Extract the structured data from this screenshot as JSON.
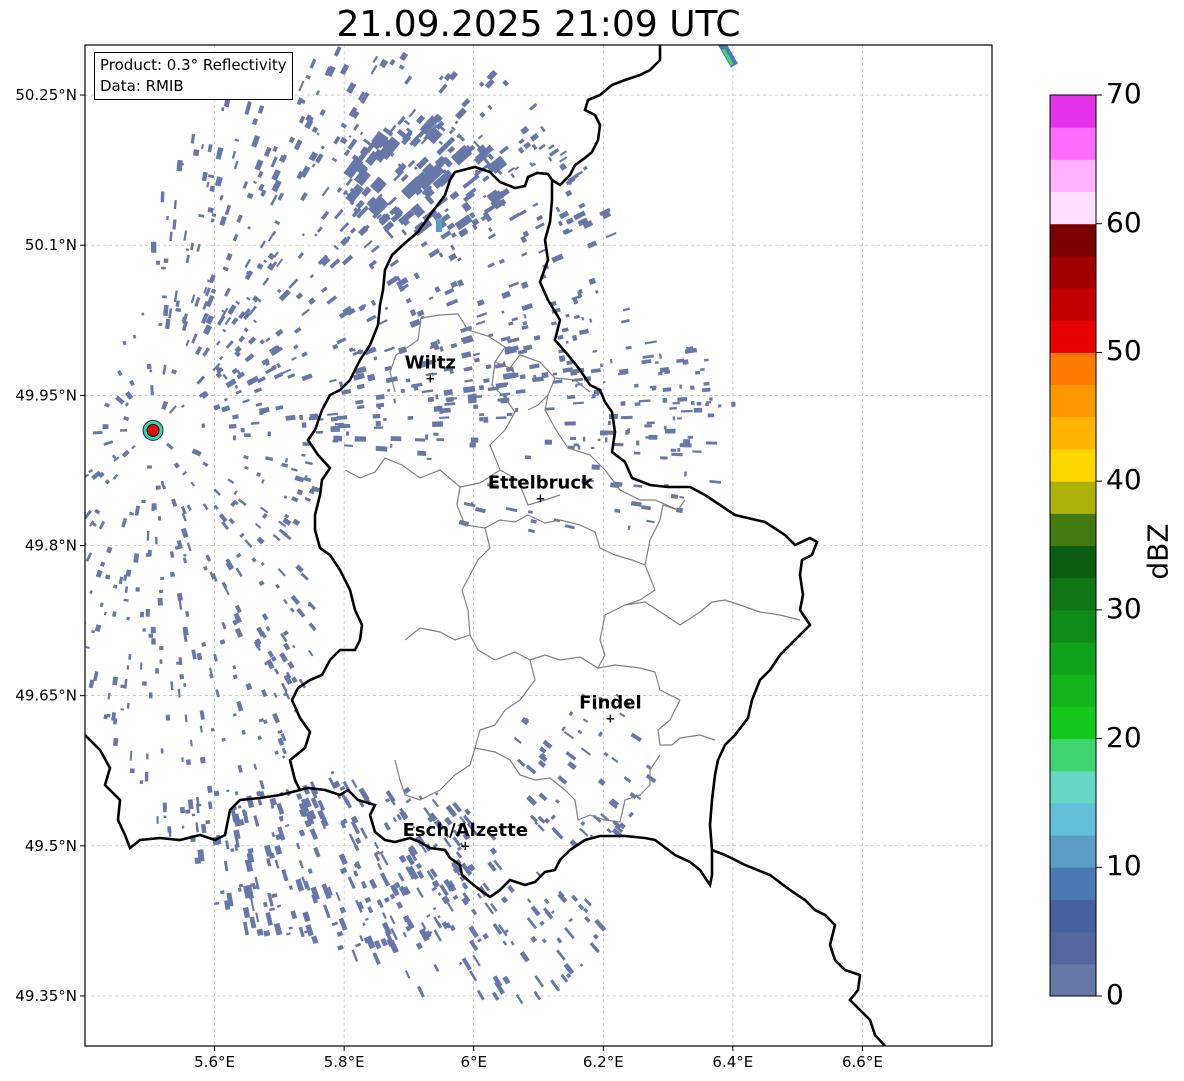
{
  "title": "21.09.2025 21:09 UTC",
  "info": {
    "product": "Product: 0.3° Reflectivity",
    "data": "Data: RMIB"
  },
  "map": {
    "lon_range": [
      5.4,
      6.8
    ],
    "lat_range": [
      49.3,
      50.3
    ],
    "x_ticks": [
      {
        "value": 5.6,
        "label": "5.6°E"
      },
      {
        "value": 5.8,
        "label": "5.8°E"
      },
      {
        "value": 6.0,
        "label": "6°E"
      },
      {
        "value": 6.2,
        "label": "6.2°E"
      },
      {
        "value": 6.4,
        "label": "6.4°E"
      },
      {
        "value": 6.6,
        "label": "6.6°E"
      }
    ],
    "y_ticks": [
      {
        "value": 50.25,
        "label": "50.25°N"
      },
      {
        "value": 50.1,
        "label": "50.1°N"
      },
      {
        "value": 49.95,
        "label": "49.95°N"
      },
      {
        "value": 49.8,
        "label": "49.8°N"
      },
      {
        "value": 49.65,
        "label": "49.65°N"
      },
      {
        "value": 49.5,
        "label": "49.5°N"
      },
      {
        "value": 49.35,
        "label": "49.35°N"
      }
    ],
    "grid": true,
    "cities": [
      {
        "name": "Wiltz",
        "lon": 5.933,
        "lat": 49.967
      },
      {
        "name": "Ettelbruck",
        "lon": 6.103,
        "lat": 49.847
      },
      {
        "name": "Findel",
        "lon": 6.211,
        "lat": 49.627
      },
      {
        "name": "Esch/Alzette",
        "lon": 5.987,
        "lat": 49.5
      }
    ],
    "radar_site": {
      "lon": 5.505,
      "lat": 49.915
    },
    "colors": {
      "background": "#ffffff",
      "country_border": "#000000",
      "canton_border": "#808080",
      "radar_site": "#e01010",
      "echo_weak": "#6777a8"
    }
  },
  "colorbar": {
    "label": "dBZ",
    "min": 0,
    "max": 70,
    "ticks": [
      "0",
      "10",
      "20",
      "30",
      "40",
      "50",
      "60",
      "70"
    ],
    "colors": [
      "#6777a8",
      "#5566a0",
      "#4660a0",
      "#4a7ab4",
      "#5a9ec6",
      "#64c0d8",
      "#64d8c4",
      "#3fd66f",
      "#14c81e",
      "#12b61c",
      "#10a219",
      "#0f8c17",
      "#0e7714",
      "#0b5e10",
      "#427a10",
      "#adb20a",
      "#ffd700",
      "#ffb500",
      "#ff9800",
      "#ff7a00",
      "#e60000",
      "#c20000",
      "#a00000",
      "#7a0000",
      "#ffe0ff",
      "#ffb2ff",
      "#ff6cff",
      "#e633ea"
    ]
  }
}
